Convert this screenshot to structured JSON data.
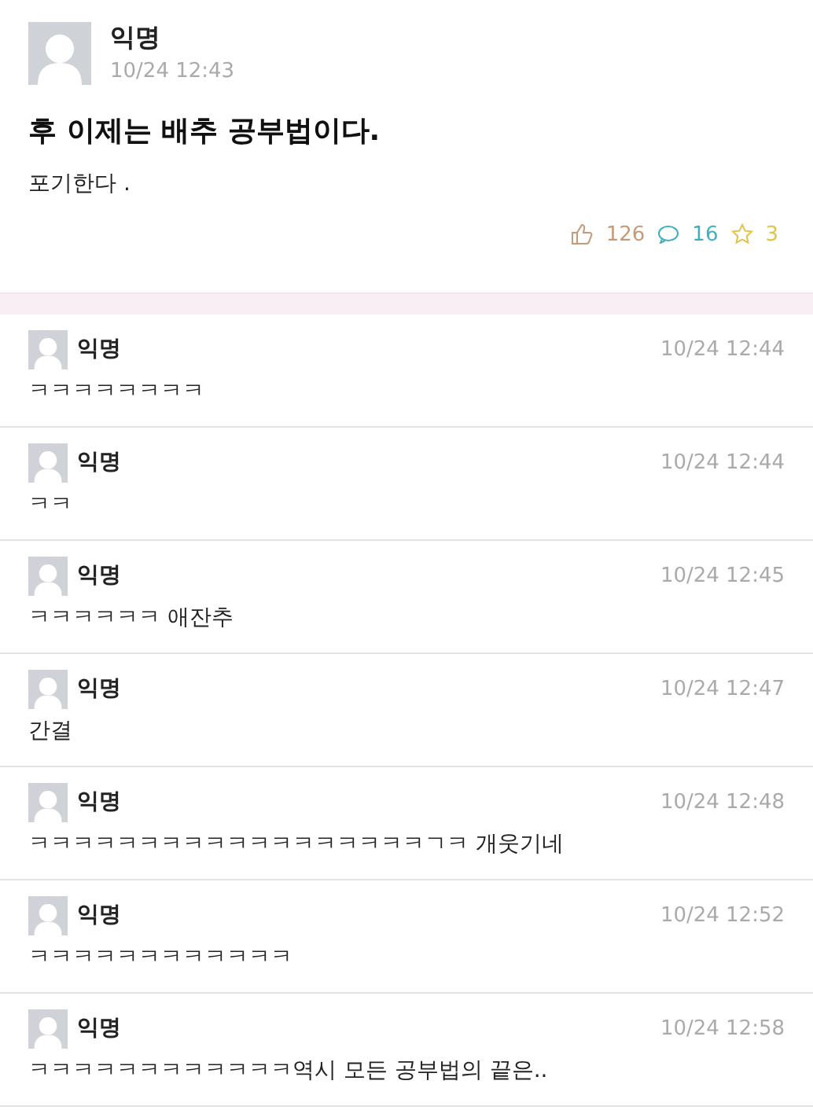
{
  "post": {
    "author": "익명",
    "time": "10/24 12:43",
    "title": "후 이제는 배추 공부법이다.",
    "body": "포기한다 .",
    "likes": "126",
    "comments": "16",
    "scraps": "3"
  },
  "comments": [
    {
      "author": "익명",
      "time": "10/24 12:44",
      "text": "ㅋㅋㅋㅋㅋㅋㅋㅋ"
    },
    {
      "author": "익명",
      "time": "10/24 12:44",
      "text": "ㅋㅋ"
    },
    {
      "author": "익명",
      "time": "10/24 12:45",
      "text": "ㅋㅋㅋㅋㅋㅋ 애잔추"
    },
    {
      "author": "익명",
      "time": "10/24 12:47",
      "text": "간결"
    },
    {
      "author": "익명",
      "time": "10/24 12:48",
      "text": "ㅋㅋㅋㅋㅋㅋㅋㅋㅋㅋㅋㅋㅋㅋㅋㅋㅋㅋㄱㅋ 개웃기네"
    },
    {
      "author": "익명",
      "time": "10/24 12:52",
      "text": "ㅋㅋㅋㅋㅋㅋㅋㅋㅋㅋㅋㅋ"
    },
    {
      "author": "익명",
      "time": "10/24 12:58",
      "text": "ㅋㅋㅋㅋㅋㅋㅋㅋㅋㅋㅋㅋ역시 모든 공부법의 끝은.."
    }
  ]
}
